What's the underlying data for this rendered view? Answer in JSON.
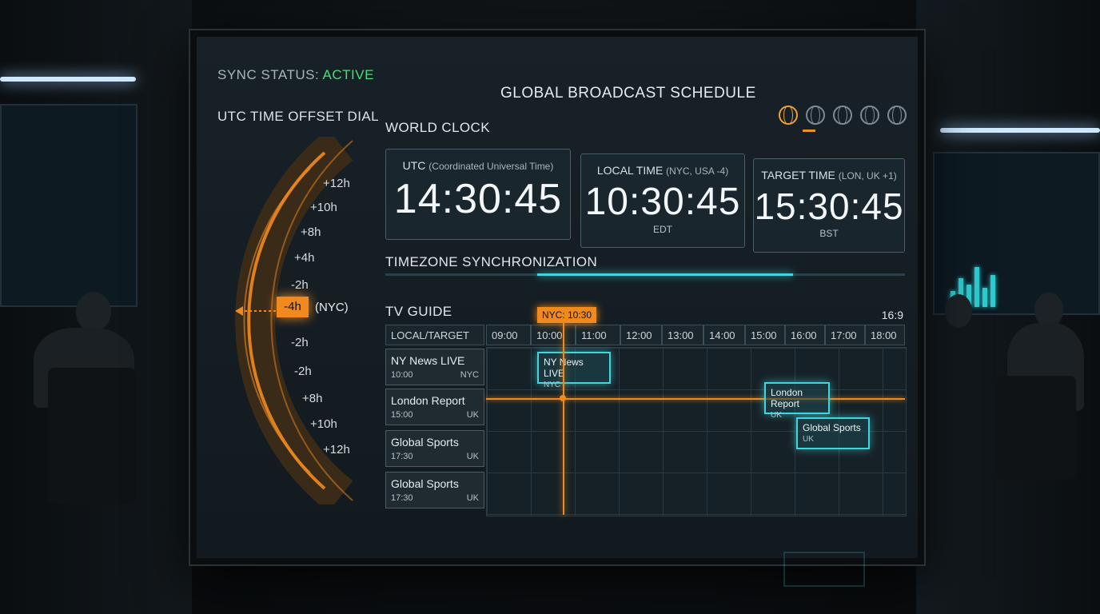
{
  "sync": {
    "label": "SYNC STATUS:",
    "state": "ACTIVE"
  },
  "title": "GLOBAL BROADCAST SCHEDULE",
  "dial": {
    "title": "UTC TIME OFFSET DIAL",
    "labels": [
      "+12h",
      "+10h",
      "+8h",
      "+4h",
      "-2h",
      "-2h",
      "-2h",
      "+8h",
      "+10h",
      "+12h"
    ],
    "selected": "-4h",
    "selected_tag": "(NYC)"
  },
  "world_clock": {
    "title": "WORLD CLOCK",
    "utc": {
      "label": "UTC",
      "sub": "(Coordinated Universal Time)",
      "time": "14:30:45"
    },
    "local": {
      "label": "LOCAL TIME",
      "sub": "(NYC, USA -4)",
      "time": "10:30:45",
      "tz": "EDT"
    },
    "target": {
      "label": "TARGET TIME",
      "sub": "(LON, UK +1)",
      "time": "15:30:45",
      "tz": "BST"
    }
  },
  "sync_section": {
    "title": "TIMEZONE SYNCHRONIZATION"
  },
  "guide": {
    "title": "TV GUIDE",
    "now_tag": "NYC: 10:30",
    "aspect": "16:9",
    "header_label": "LOCAL/TARGET",
    "hours": [
      "09:00",
      "10:00",
      "11:00",
      "12:00",
      "13:00",
      "14:00",
      "15:00",
      "16:00",
      "17:00",
      "18:00"
    ],
    "rows": [
      {
        "name": "NY News LIVE",
        "time": "10:00",
        "region": "NYC"
      },
      {
        "name": "London Report",
        "time": "15:00",
        "region": "UK"
      },
      {
        "name": "Global Sports",
        "time": "17:30",
        "region": "UK"
      },
      {
        "name": "Global Sports",
        "time": "17:30",
        "region": "UK"
      }
    ],
    "programs": [
      {
        "name": "NY News LIVE",
        "region": "NYC"
      },
      {
        "name": "London Report",
        "region": "UK"
      },
      {
        "name": "Global Sports",
        "region": "UK"
      }
    ]
  },
  "colors": {
    "accent": "#f08a1e",
    "cyan": "#3fd6e0",
    "active": "#4ddc7a"
  }
}
